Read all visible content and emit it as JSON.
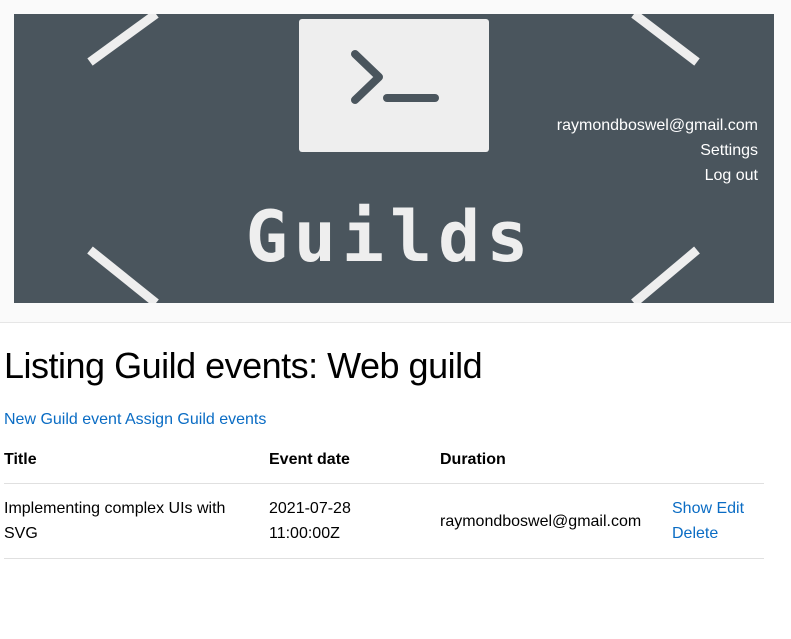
{
  "colors": {
    "banner_bg": "#4a555d",
    "banner_fg": "#eeeeee",
    "link": "#0a6cc4"
  },
  "header": {
    "logo": {
      "text": "Guilds",
      "icon": "terminal-prompt-icon"
    },
    "user_menu": {
      "email": "raymondboswel@gmail.com",
      "settings": "Settings",
      "logout": "Log out"
    }
  },
  "main": {
    "title": "Listing Guild events: Web guild",
    "actions": {
      "new": "New Guild event",
      "assign": "Assign Guild events"
    },
    "table": {
      "headers": [
        "Title",
        "Event date",
        "Duration",
        ""
      ],
      "rows": [
        {
          "title": "Implementing complex UIs with SVG",
          "event_date": "2021-07-28 11:00:00Z",
          "duration": "raymondboswel@gmail.com",
          "show": "Show",
          "edit": "Edit",
          "delete": "Delete"
        }
      ]
    }
  }
}
